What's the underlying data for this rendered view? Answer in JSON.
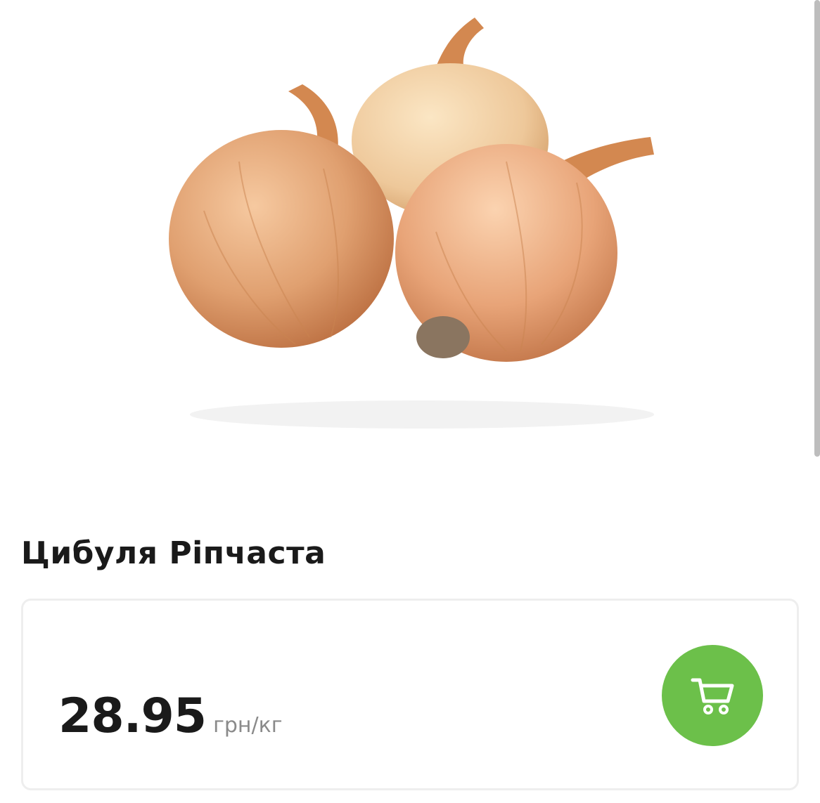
{
  "product": {
    "image_icon": "onion-photo",
    "title": "Цибуля Ріпчаста"
  },
  "price_card": {
    "price": "28.95",
    "unit": "грн/кг",
    "cart_icon": "cart-icon",
    "accent_color": "#6cc04a"
  }
}
